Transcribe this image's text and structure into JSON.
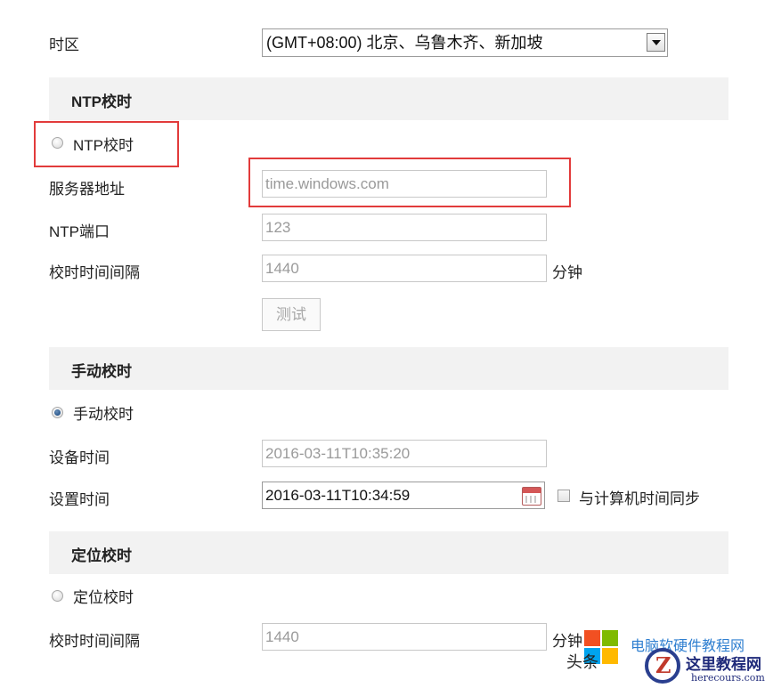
{
  "timezone": {
    "label": "时区",
    "selected": "(GMT+08:00) 北京、乌鲁木齐、新加坡"
  },
  "ntp_section": {
    "title": "NTP校时",
    "radio_label": "NTP校时",
    "radio_selected": false,
    "server_label": "服务器地址",
    "server_value": "time.windows.com",
    "port_label": "NTP端口",
    "port_value": "123",
    "interval_label": "校时时间间隔",
    "interval_value": "1440",
    "interval_unit": "分钟",
    "test_button": "测试"
  },
  "manual_section": {
    "title": "手动校时",
    "radio_label": "手动校时",
    "radio_selected": true,
    "device_time_label": "设备时间",
    "device_time_value": "2016-03-11T10:35:20",
    "set_time_label": "设置时间",
    "set_time_value": "2016-03-11T10:34:59",
    "sync_checkbox_label": "与计算机时间同步",
    "sync_checked": false
  },
  "gps_section": {
    "title": "定位校时",
    "radio_label": "定位校时",
    "radio_selected": false,
    "interval_label": "校时时间间隔",
    "interval_value": "1440",
    "interval_unit": "分钟"
  },
  "watermark": {
    "text_left": "头条",
    "text_blue": "电脑软硬件教程网",
    "site_name": "这里教程网",
    "site_url": "herecours.com"
  },
  "colors": {
    "highlight_box": "#e23b3b",
    "section_bg": "#f2f2f2",
    "radio_selected": "#1f4f86"
  }
}
